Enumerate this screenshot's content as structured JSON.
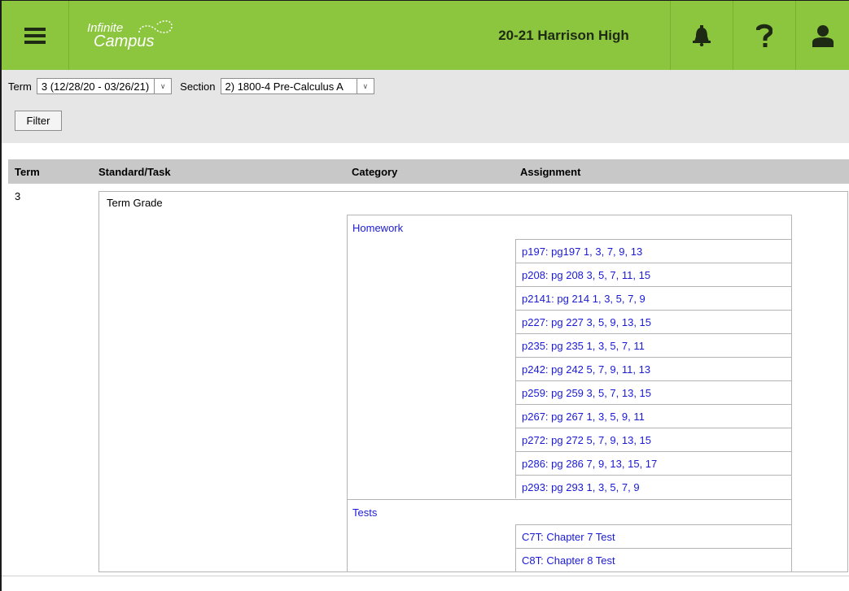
{
  "header": {
    "menu_icon": "hamburger-menu-icon",
    "logo_line1": "Infinite",
    "logo_line2": "Campus",
    "school": "20-21 Harrison High",
    "bell_icon": "bell-icon",
    "help_icon": "question-mark-icon",
    "user_icon": "user-icon",
    "brand_color": "#8cc63f"
  },
  "filters": {
    "term_label": "Term",
    "term_value": "3 (12/28/20 - 03/26/21)",
    "section_label": "Section",
    "section_value": "2) 1800-4 Pre-Calculus A",
    "filter_button": "Filter"
  },
  "table": {
    "columns": [
      "Term",
      "Standard/Task",
      "Category",
      "Assignment"
    ],
    "term": "3",
    "standard": "Term Grade",
    "categories": [
      {
        "name": "Homework",
        "assignments": [
          "p197: pg197 1, 3, 7, 9, 13",
          "p208: pg 208 3, 5, 7, 11, 15",
          "p2141: pg 214 1, 3, 5, 7, 9",
          "p227: pg 227 3, 5, 9, 13, 15",
          "p235: pg 235 1, 3, 5, 7, 11",
          "p242: pg 242 5, 7, 9, 11, 13",
          "p259: pg 259 3, 5, 7, 13, 15",
          "p267: pg 267 1, 3, 5, 9, 11",
          "p272: pg 272 5, 7, 9, 13, 15",
          "p286: pg 286 7, 9, 13, 15, 17",
          "p293: pg 293 1, 3, 5, 7, 9"
        ]
      },
      {
        "name": "Tests",
        "assignments": [
          "C7T: Chapter 7 Test",
          "C8T: Chapter 8 Test"
        ]
      }
    ]
  }
}
